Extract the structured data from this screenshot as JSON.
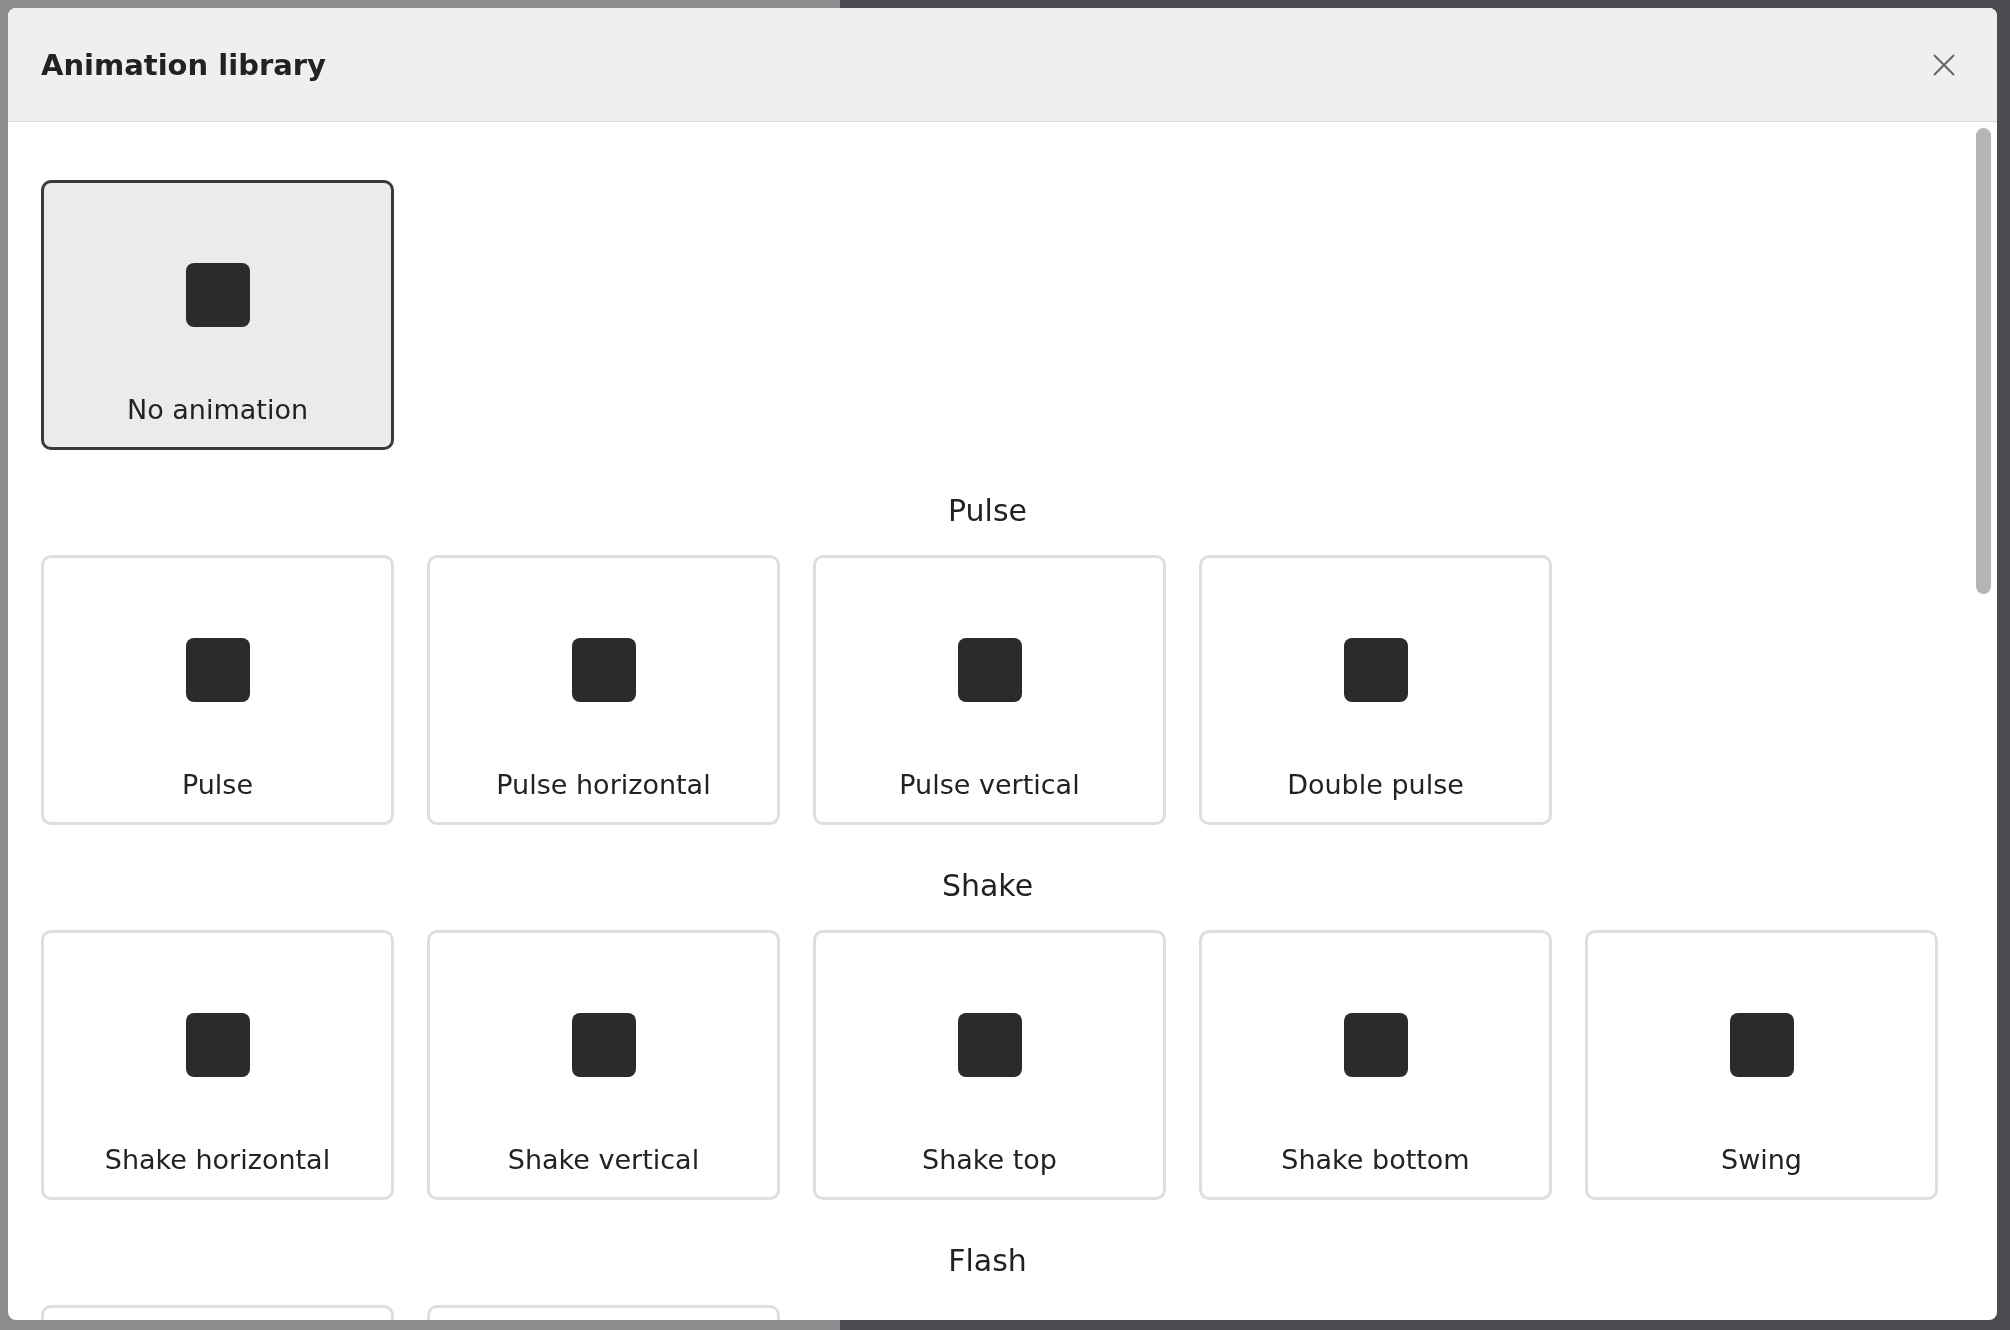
{
  "dialog": {
    "title": "Animation library"
  },
  "sections": [
    {
      "cards": [
        {
          "label": "No animation",
          "selected": true
        }
      ]
    },
    {
      "heading": "Pulse",
      "cards": [
        {
          "label": "Pulse",
          "selected": false
        },
        {
          "label": "Pulse horizontal",
          "selected": false
        },
        {
          "label": "Pulse vertical",
          "selected": false
        },
        {
          "label": "Double pulse",
          "selected": false
        }
      ]
    },
    {
      "heading": "Shake",
      "cards": [
        {
          "label": "Shake horizontal",
          "selected": false
        },
        {
          "label": "Shake vertical",
          "selected": false
        },
        {
          "label": "Shake top",
          "selected": false
        },
        {
          "label": "Shake bottom",
          "selected": false
        },
        {
          "label": "Swing",
          "selected": false
        }
      ]
    },
    {
      "heading": "Flash",
      "cards": [
        {
          "selected": false
        },
        {
          "selected": false
        }
      ]
    }
  ]
}
